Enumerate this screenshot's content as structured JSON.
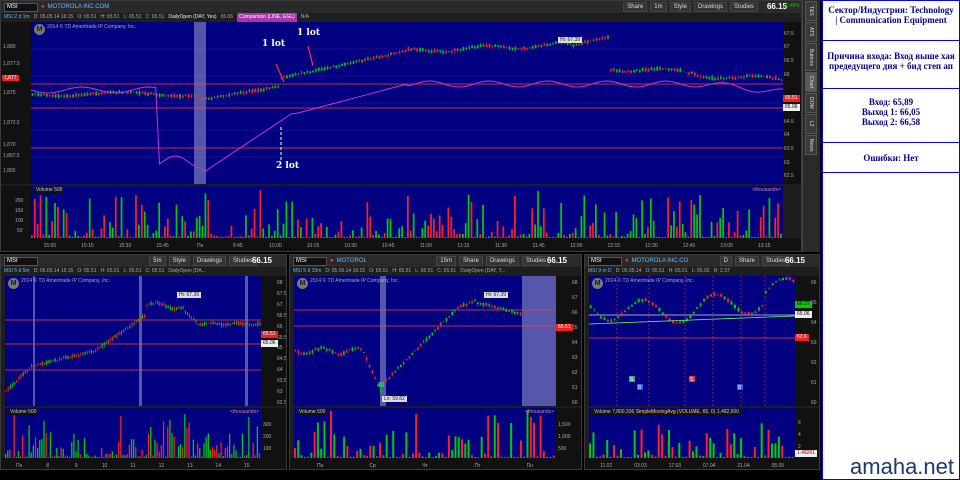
{
  "main": {
    "symbol": "MSI",
    "aggregation": "MSI 2 d 1m",
    "company_link": "MOTOROLA INC.COM",
    "info": [
      "D: 05.05.14 16:15",
      "O: 65.51",
      "H: 65.51",
      "L: 65.51",
      "C: 65.51"
    ],
    "study1": "DailyOpen (DAY, Yes)",
    "study1_val": "65.06",
    "study2": "Comparison (LINE, EGL)",
    "study2_val": "N/A",
    "toolbar": {
      "share": "Share",
      "period": "1m",
      "style": "Style",
      "drawings": "Drawings",
      "studies": "Studies"
    },
    "last_price": "66.15",
    "change": "+0.48%",
    "copyright": "2014 © TD Ameritrade IP Company, Inc.",
    "y_ticks": [
      "1,880",
      "1,877.5",
      "1,875",
      "1,872.5",
      "1,870",
      "1,867.5",
      "1,865"
    ],
    "y_ticks_right": [
      "67.5",
      "67",
      "66.5",
      "66",
      "65.5",
      "65",
      "64.5",
      "64",
      "63.5",
      "63",
      "62.5"
    ],
    "current_value_tag": "1,877",
    "tag_red": "65.51",
    "tag_white": "65.06",
    "hi_label": "Hi: 67.39",
    "annotations": [
      "1 lot",
      "1 lot",
      "2 lot"
    ],
    "volume_label": "Volume",
    "volume_val": "500",
    "volume_right": "<thousands>",
    "vol_ticks": [
      "200",
      "150",
      "100",
      "50"
    ],
    "x_ticks": [
      "15:00",
      "15:15",
      "15:30",
      "15:45",
      "Пн",
      "9:45",
      "10:00",
      "10:15",
      "10:30",
      "10:45",
      "11:00",
      "11:15",
      "11:30",
      "11:45",
      "12:00",
      "12:15",
      "12:30",
      "12:45",
      "13:00",
      "13:15"
    ]
  },
  "side_tabs": [
    "T&S",
    "ATS",
    "Buttons",
    "Chart",
    "DOM",
    "L2",
    "News"
  ],
  "sub_left": {
    "symbol": "MSI",
    "aggregation": "MSI 5 d 5m",
    "info": [
      "D: 05.05.14 16:15",
      "O: 65.51",
      "H: 65.51",
      "L: 65.51",
      "C: 65.51",
      "DailyOpen (DA..."
    ],
    "period": "5m",
    "toolbar": {
      "style": "Style",
      "drawings": "Drawings",
      "studies": "Studies"
    },
    "last_price": "66.15",
    "hi_label": "Hi: 67.39",
    "tag_red": "65.51",
    "tag_white": "65.06",
    "y_ticks": [
      "68",
      "67.5",
      "67",
      "66.5",
      "66",
      "65.5",
      "65",
      "64.5",
      "64",
      "63.5",
      "63",
      "62.5"
    ],
    "volume_val": "500",
    "volume_right": "<thousands>",
    "vol_ticks": [
      "300",
      "200",
      "100"
    ],
    "x_ticks": [
      "Пн",
      "8",
      "9",
      "10",
      "11",
      "12",
      "13",
      "14",
      "15"
    ]
  },
  "sub_mid": {
    "symbol": "MSI",
    "company_link": "MOTOROL",
    "aggregation": "MSI 5 d 15m",
    "info": [
      "D: 05.05.14 16:15",
      "O: 65.51",
      "H: 65.51",
      "L: 65.51",
      "C: 65.51",
      "DailyOpen (DAY, Y..."
    ],
    "period": "15m",
    "toolbar": {
      "share": "Share",
      "drawings": "Drawings",
      "studies": "Studies"
    },
    "last_price": "66.15",
    "hi_label": "Hi: 67.39",
    "lo_label": "Lo: 59.82",
    "tag_red": "65.51",
    "y_ticks": [
      "68",
      "67",
      "66",
      "65",
      "64",
      "63",
      "62",
      "61",
      "60"
    ],
    "volume_val": "500",
    "volume_right": "<thousands>",
    "vol_ticks": [
      "1,500",
      "1,000",
      "500"
    ],
    "x_ticks": [
      "Пн",
      "Ср",
      "Чт",
      "Пт",
      "Пн"
    ]
  },
  "sub_right": {
    "symbol": "MSI",
    "company_link": "MOTOROLA INC.CO",
    "aggregation": "MSI 9 m D",
    "info": [
      "D: 05.05.14",
      "O: 65.51",
      "H: 65.51",
      "L: 65.02",
      "R: 2.37"
    ],
    "period": "D",
    "toolbar": {
      "share": "Share",
      "studies": "Studies"
    },
    "last_price": "66.15",
    "tag_green": "66.15",
    "tag_white": "65.06",
    "tag_red": "62.6",
    "volume_label": "Volume",
    "volume_val": "7,800,336",
    "sma_label": "SimpleMovingAvg (VOLUME, 65, 0)",
    "sma_val": "1,482,600",
    "volume_right": "<millions>",
    "vol_ticks": [
      "6",
      "4",
      "2"
    ],
    "vol_tag": "1.48261",
    "y_ticks": [
      "66",
      "65",
      "64",
      "63",
      "62",
      "61",
      "60"
    ],
    "x_ticks": [
      "11.02",
      "03.03",
      "17.03",
      "07.04",
      "21.04",
      "05.05"
    ],
    "markers": [
      "S",
      "B",
      "S",
      "B"
    ]
  },
  "note": {
    "sector": "Сектор/Индустрия: Technology | Communication Equipment",
    "reason": "Причина входа: Вход выше хая предедущего дня + бид степ ап",
    "entry": "Вход: 65,89",
    "exit1": "Выход 1: 66,05",
    "exit2": "Выход 2: 66,58",
    "errors": "Ошибки: Нет"
  },
  "watermark": "amaha.net",
  "colors": {
    "plot_bg": "#000080",
    "candle_up": "#00cc00",
    "candle_down": "#ff2020",
    "comparison": "#cc33cc",
    "level": "#ff4040",
    "note_text": "#00008b"
  }
}
